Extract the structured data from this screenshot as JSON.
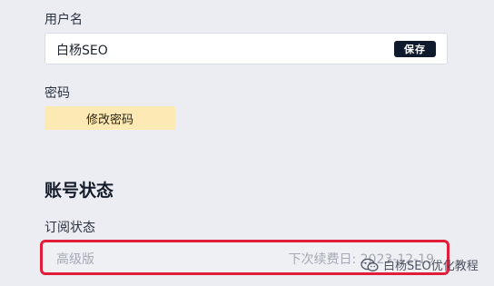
{
  "username": {
    "label": "用户名",
    "value": "白杨SEO",
    "save_label": "保存"
  },
  "password": {
    "label": "密码",
    "change_label": "修改密码"
  },
  "account_status": {
    "heading": "账号状态",
    "subscription_label": "订阅状态",
    "plan_name": "高级版",
    "renewal_text": "下次续费日: 2023-12-19"
  },
  "watermark": {
    "text": "白杨SEO优化教程",
    "icon": "wechat-icon"
  },
  "colors": {
    "background": "#ecedf2",
    "save_button": "#0f1b2d",
    "change_password_button": "#fde9b3",
    "highlight_border": "#e11d3a"
  }
}
